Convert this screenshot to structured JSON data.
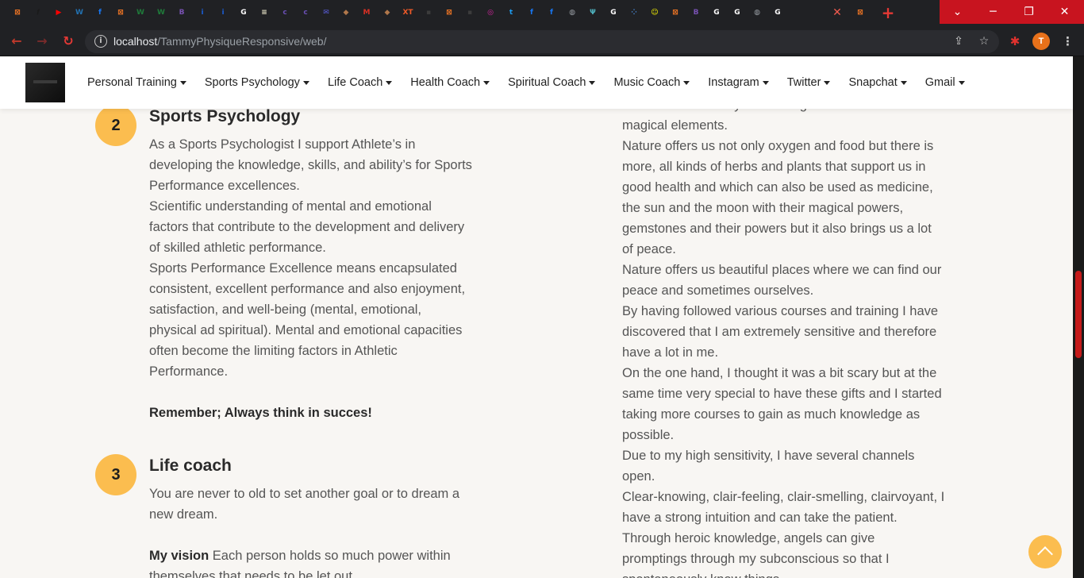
{
  "browser": {
    "tab_icons": [
      {
        "name": "xampp-icon",
        "color": "#fb7a24",
        "glyph": "⊠"
      },
      {
        "name": "leaf-icon",
        "color": "#1a1a1a",
        "glyph": "𝒇"
      },
      {
        "name": "youtube-icon",
        "color": "#ff0000",
        "glyph": "▶"
      },
      {
        "name": "wordpress-icon",
        "color": "#2271b1",
        "glyph": "W"
      },
      {
        "name": "facebook-icon",
        "color": "#1877f2",
        "glyph": "f"
      },
      {
        "name": "xampp-icon",
        "color": "#fb7a24",
        "glyph": "⊠"
      },
      {
        "name": "w-green-icon",
        "color": "#1f7a3a",
        "glyph": "W"
      },
      {
        "name": "w-green-icon",
        "color": "#1f7a3a",
        "glyph": "W"
      },
      {
        "name": "bootstrap-icon",
        "color": "#7952b3",
        "glyph": "B"
      },
      {
        "name": "info-icon",
        "color": "#1a5ed6",
        "glyph": "i"
      },
      {
        "name": "info-icon",
        "color": "#1a5ed6",
        "glyph": "i"
      },
      {
        "name": "google-icon",
        "color": "#ffffff",
        "glyph": "G"
      },
      {
        "name": "card-icon",
        "color": "#e9e4c8",
        "glyph": "≡"
      },
      {
        "name": "colorlib-icon",
        "color": "#6a4fb3",
        "glyph": "c"
      },
      {
        "name": "colorlib-icon",
        "color": "#6a4fb3",
        "glyph": "c"
      },
      {
        "name": "mail-icon",
        "color": "#5b5fe0",
        "glyph": "✉"
      },
      {
        "name": "cake-icon",
        "color": "#b0774b",
        "glyph": "◆"
      },
      {
        "name": "gmail-icon",
        "color": "#d93025",
        "glyph": "M"
      },
      {
        "name": "cake-icon",
        "color": "#b0774b",
        "glyph": "◆"
      },
      {
        "name": "xt-icon",
        "color": "#f05a28",
        "glyph": "XT"
      },
      {
        "name": "dark-icon",
        "color": "#3c3c3c",
        "glyph": "▪"
      },
      {
        "name": "xampp-icon",
        "color": "#fb7a24",
        "glyph": "⊠"
      },
      {
        "name": "dark-icon",
        "color": "#3c3c3c",
        "glyph": "▪"
      },
      {
        "name": "instagram-icon",
        "color": "#d6249f",
        "glyph": "◎"
      },
      {
        "name": "twitter-icon",
        "color": "#1d9bf0",
        "glyph": "t"
      },
      {
        "name": "facebook-icon",
        "color": "#1877f2",
        "glyph": "f"
      },
      {
        "name": "facebook-icon",
        "color": "#1877f2",
        "glyph": "f"
      },
      {
        "name": "globe-icon",
        "color": "#9aa0a6",
        "glyph": "◍"
      },
      {
        "name": "psi-icon",
        "color": "#4fb3bf",
        "glyph": "Ψ"
      },
      {
        "name": "google-icon",
        "color": "#ffffff",
        "glyph": "G"
      },
      {
        "name": "dots-icon",
        "color": "#4a90e2",
        "glyph": "⁘"
      },
      {
        "name": "snapchat-icon",
        "color": "#fffc00",
        "glyph": "☺"
      },
      {
        "name": "xampp-icon",
        "color": "#fb7a24",
        "glyph": "⊠"
      },
      {
        "name": "bootstrap-icon",
        "color": "#7952b3",
        "glyph": "B"
      },
      {
        "name": "google-icon",
        "color": "#ffffff",
        "glyph": "G"
      },
      {
        "name": "google-icon",
        "color": "#ffffff",
        "glyph": "G"
      },
      {
        "name": "globe-icon",
        "color": "#9aa0a6",
        "glyph": "◍"
      },
      {
        "name": "google-icon",
        "color": "#ffffff",
        "glyph": "G"
      }
    ],
    "last_tab_icon": {
      "name": "xampp-icon",
      "color": "#fb7a24",
      "glyph": "⊠"
    },
    "url_host": "localhost",
    "url_path": "/TammyPhysiqueResponsive/web/",
    "profile_initial": "T"
  },
  "nav": {
    "items": [
      "Personal Training",
      "Sports Psychology",
      "Life Coach",
      "Health Coach",
      "Spiritual Coach",
      "Music Coach",
      "Instagram",
      "Twitter",
      "Snapchat",
      "Gmail"
    ]
  },
  "sections": {
    "sports": {
      "number": "2",
      "title": "Sports Psychology",
      "lines": [
        "As a Sports Psychologist I support Athlete’s in",
        "developing the knowledge, skills, and ability’s for Sports",
        "Performance excellences.",
        "Scientific understanding of mental and emotional",
        "factors that contribute to the development and delivery",
        "of skilled athletic performance.",
        "Sports Performance Excellence means encapsulated",
        "consistent, excellent performance and also enjoyment,",
        "satisfaction, and well-being (mental, emotional,",
        "physical ad spiritual). Mental and emotional capacities",
        "often become the limiting factors in Athletic",
        "Performance."
      ],
      "remember": "Remember; Always think in succes!"
    },
    "life": {
      "number": "3",
      "title": "Life coach",
      "lines": [
        "You are never to old to set another goal or to dream a",
        "new dream."
      ],
      "vision_label": "My vision",
      "vision_text": " Each person holds so much power within",
      "vision_line2": "themselves that needs to be let out"
    }
  },
  "right_column": {
    "lines": [
      "What I also find very fascinating is nature and all its",
      "magical elements.",
      "Nature offers us not only oxygen and food but there is",
      "more, all kinds of herbs and plants that support us in",
      "good health and which can also be used as medicine,",
      "the sun and the moon with their magical powers,",
      "gemstones and their powers but it also brings us a lot",
      "of peace.",
      "Nature offers us beautiful places where we can find our",
      "peace and sometimes ourselves.",
      "By having followed various courses and training I have",
      "discovered that I am extremely sensitive and therefore",
      "have a lot in me.",
      "On the one hand, I thought it was a bit scary but at the",
      "same time very special to have these gifts and I started",
      "taking more courses to gain as much knowledge as",
      "possible.",
      "Due to my high sensitivity, I have several channels",
      "open.",
      "Clear-knowing, clair-feeling, clair-smelling, clairvoyant, I",
      "have a strong intuition and can take the patient.",
      "Through heroic knowledge, angels can give",
      "promptings through my subconscious so that I",
      "spontaneously know things."
    ]
  },
  "colors": {
    "accent": "#fbbd4f",
    "page_bg": "#f8f6f3",
    "heading": "#2a2a2a",
    "body_text": "#555555"
  }
}
